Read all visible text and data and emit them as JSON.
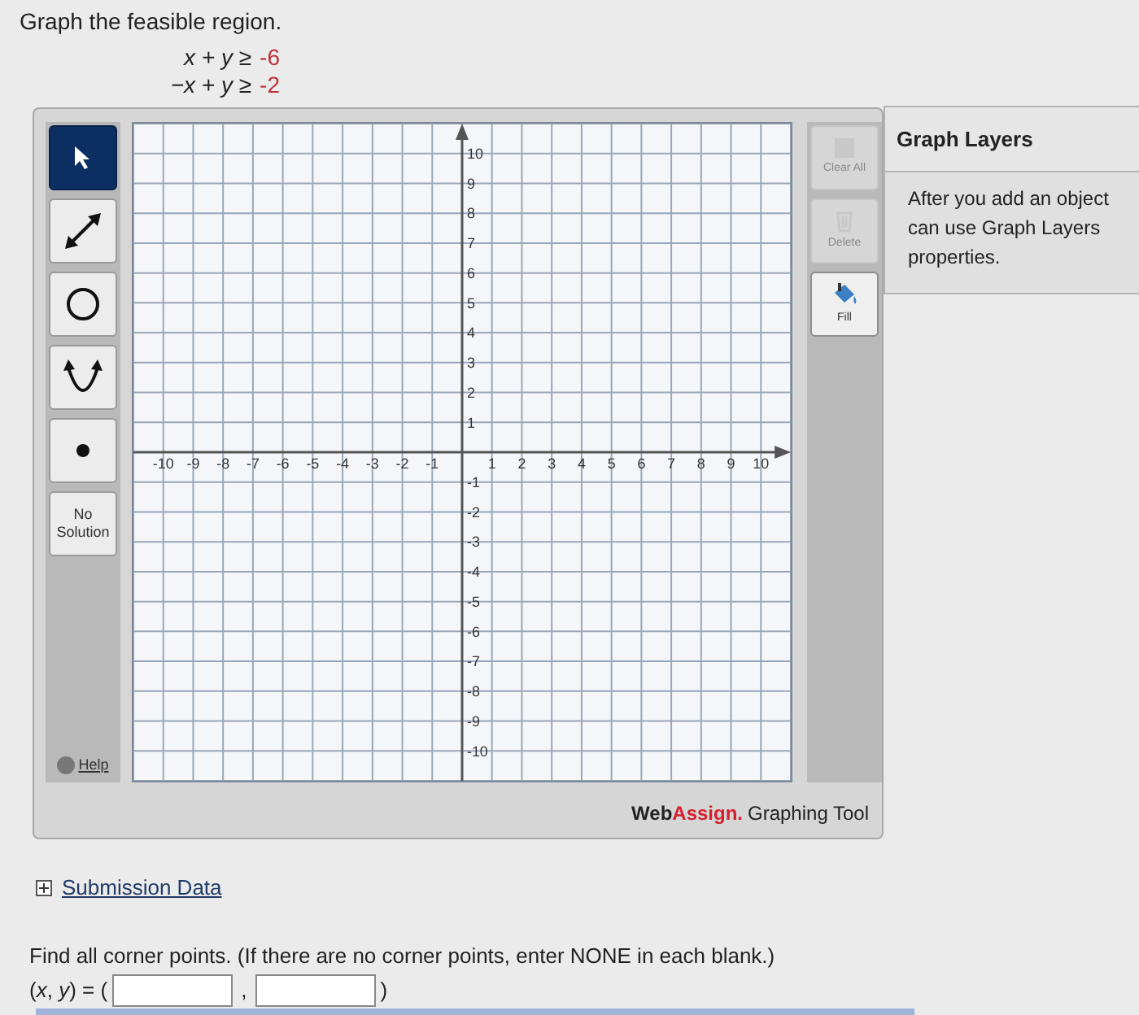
{
  "prompt": "Graph the feasible region.",
  "inequalities": [
    {
      "lhs": "x + y ≥",
      "rhs": "-6"
    },
    {
      "lhs": "−x + y ≥",
      "rhs": "-2"
    }
  ],
  "tools": [
    {
      "kind": "pointer",
      "selected": true
    },
    {
      "kind": "line",
      "selected": false
    },
    {
      "kind": "circle",
      "selected": false
    },
    {
      "kind": "parabola",
      "selected": false
    },
    {
      "kind": "point",
      "selected": false
    },
    {
      "kind": "text",
      "label": "No Solution",
      "selected": false
    }
  ],
  "help": "Help",
  "graph": {
    "x_tick_labels": [
      "-10",
      "-9",
      "-8",
      "-7",
      "-6",
      "-5",
      "-4",
      "-3",
      "-2",
      "-1",
      "1",
      "2",
      "3",
      "4",
      "5",
      "6",
      "7",
      "8",
      "9",
      "10"
    ],
    "y_tick_labels": [
      "10",
      "9",
      "8",
      "7",
      "6",
      "5",
      "4",
      "3",
      "2",
      "1",
      "-1",
      "-2",
      "-3",
      "-4",
      "-5",
      "-6",
      "-7",
      "-8",
      "-9",
      "-10"
    ]
  },
  "actions": [
    {
      "kind": "clear",
      "label": "Clear All",
      "disabled": true
    },
    {
      "kind": "delete",
      "label": "Delete",
      "disabled": true
    },
    {
      "kind": "fill",
      "label": "Fill",
      "disabled": false
    }
  ],
  "brand": {
    "web": "Web",
    "assign": "Assign.",
    "product": "Graphing Tool"
  },
  "layers": {
    "title": "Graph Layers",
    "lines": [
      "After you add an object",
      "can use Graph Layers",
      "properties."
    ]
  },
  "submission": {
    "label": "Submission Data",
    "expanded": false
  },
  "question": "Find all corner points. (If there are no corner points, enter NONE in each blank.)",
  "answer": {
    "prefix": "(*x*, *y*) = (",
    "separator": ",",
    "suffix": ")"
  }
}
